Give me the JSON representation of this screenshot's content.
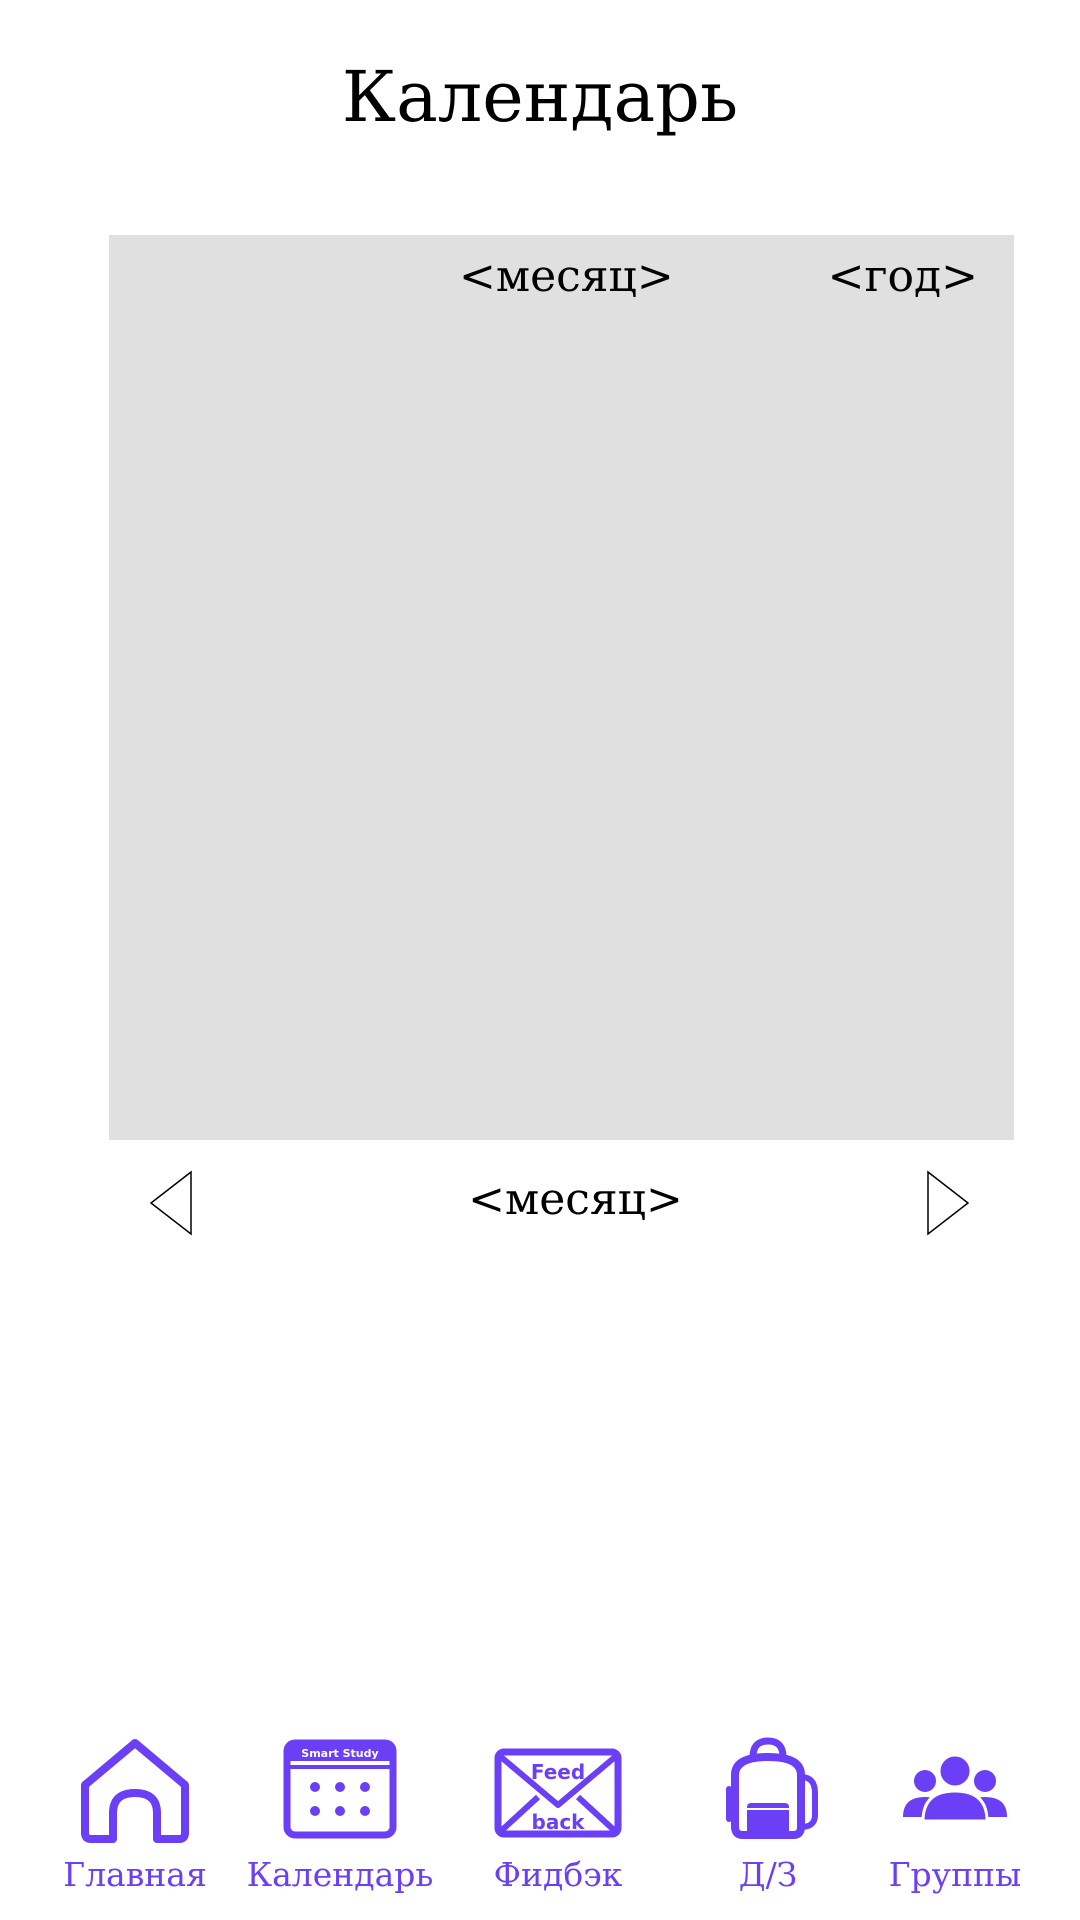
{
  "header": {
    "title": "Календарь"
  },
  "calendar": {
    "month_placeholder": "<месяц>",
    "year_placeholder": "<год>"
  },
  "month_nav": {
    "prev_icon": "triangle-left-icon",
    "next_icon": "triangle-right-icon",
    "month_placeholder": "<месяц>"
  },
  "bottom_nav": {
    "items": [
      {
        "label": "Главная",
        "icon": "home-icon"
      },
      {
        "label": "Календарь",
        "icon": "calendar-icon",
        "icon_text": "Smart Study"
      },
      {
        "label": "Фидбэк",
        "icon": "feedback-envelope-icon",
        "icon_text_top": "Feed",
        "icon_text_bottom": "back"
      },
      {
        "label": "Д/З",
        "icon": "backpack-icon"
      },
      {
        "label": "Группы",
        "icon": "group-icon"
      }
    ]
  },
  "colors": {
    "accent": "#6a3ff5",
    "panel": "#e0e0e0",
    "text": "#000000",
    "background": "#ffffff"
  }
}
